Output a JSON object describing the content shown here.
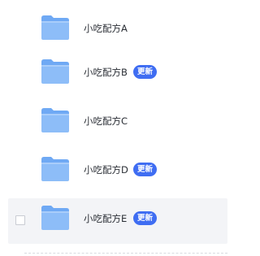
{
  "folder_list": {
    "items": [
      {
        "name": "小吃配方A",
        "badge": ""
      },
      {
        "name": "小吃配方B",
        "badge": "更新"
      },
      {
        "name": "小吃配方C",
        "badge": ""
      },
      {
        "name": "小吃配方D",
        "badge": "更新"
      },
      {
        "name": "小吃配方E",
        "badge": "更新"
      }
    ]
  },
  "colors": {
    "badge_bg": "#3f6df2",
    "folder_blue": "#86b8f7",
    "hover_bg": "#f3f4f7"
  },
  "icons": {
    "folder": "folder-icon",
    "checkbox": "checkbox"
  }
}
